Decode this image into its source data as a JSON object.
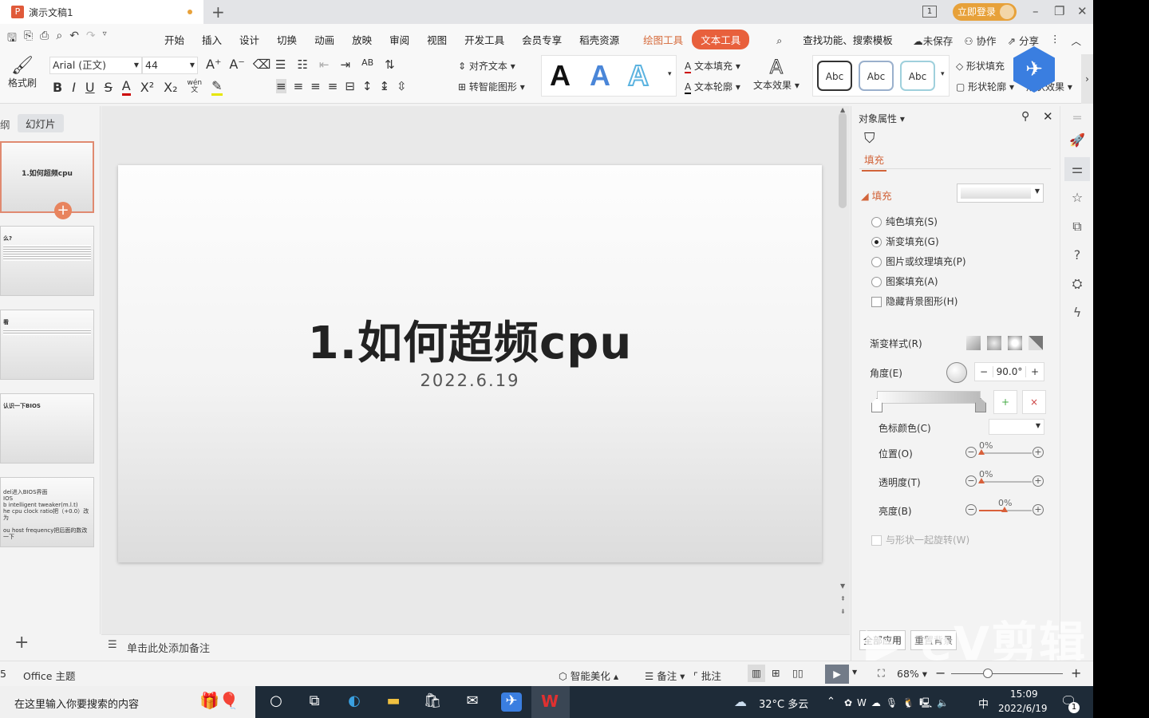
{
  "title_bar": {
    "doc_tab": "演示文稿1",
    "app_icon": "P",
    "login": "立即登录",
    "window_counter": "1"
  },
  "menu": {
    "items": [
      "开始",
      "插入",
      "设计",
      "切换",
      "动画",
      "放映",
      "审阅",
      "视图",
      "开发工具",
      "会员专享",
      "稻壳资源"
    ],
    "drawing_tools": "绘图工具",
    "text_tools": "文本工具",
    "search_placeholder": "查找功能、搜索模板",
    "unsaved": "未保存",
    "collaborate": "协作",
    "share": "分享"
  },
  "ribbon": {
    "format_painter": "格式刷",
    "font_name": "Arial (正文)",
    "font_size": "44",
    "align_text": "对齐文本",
    "smart_shape": "转智能图形",
    "text_fill": "文本填充",
    "text_outline": "文本轮廓",
    "text_effect": "文本效果",
    "shape_styles": [
      "Abc",
      "Abc",
      "Abc"
    ],
    "shape_fill": "形状填充",
    "shape_outline": "形状轮廓",
    "shape_effect": "形状效果",
    "wordart": [
      "A",
      "A",
      "A"
    ],
    "phonetic": "wén"
  },
  "left_panel": {
    "tab_outline": "纲",
    "tab_slides": "幻灯片",
    "thumbs": [
      {
        "title": "1.如何超频cpu",
        "body": ""
      },
      {
        "title": "么?",
        "body": ""
      },
      {
        "title": "看",
        "body": ""
      },
      {
        "title": "认识一下BIOS",
        "body": ""
      },
      {
        "title": "",
        "body": "del进入BIOS界面\nIOS\nb intelligent tweaker(m.l.t)\nhe cpu clock ratio把（+0.0）改为\n\nou host frequency把后面的数改一下"
      }
    ]
  },
  "slide": {
    "title": "1.如何超频cpu",
    "subtitle": "2022.6.19"
  },
  "notes_placeholder": "单击此处添加备注",
  "right_panel": {
    "header": "对象属性",
    "tab": "填充",
    "section": "填充",
    "options": [
      "纯色填充(S)",
      "渐变填充(G)",
      "图片或纹理填充(P)",
      "图案填充(A)"
    ],
    "selected_option": 1,
    "hide_bg": "隐藏背景图形(H)",
    "gradient_style": "渐变样式(R)",
    "angle_label": "角度(E)",
    "angle_value": "90.0°",
    "stop_color": "色标颜色(C)",
    "position_label": "位置(O)",
    "position_value": "0%",
    "transparency_label": "透明度(T)",
    "transparency_value": "0%",
    "brightness_label": "亮度(B)",
    "brightness_value": "0%",
    "rotate_with_shape": "与形状一起旋转(W)",
    "apply_all": "全部应用",
    "reset_bg": "重置背景"
  },
  "status_bar": {
    "slide_count": "5",
    "theme": "Office 主题",
    "beautify": "智能美化",
    "notes": "备注",
    "comments": "批注",
    "zoom": "68%"
  },
  "taskbar": {
    "search_placeholder": "在这里输入你要搜索的内容",
    "weather": "32°C 多云",
    "ime": "中",
    "time": "15:09",
    "date": "2022/6/19",
    "notif_count": "1"
  },
  "watermark": "eV剪辑",
  "colors": {
    "accent": "#e8603c",
    "login": "#e7a13a",
    "taskbar": "#1e2b38"
  }
}
